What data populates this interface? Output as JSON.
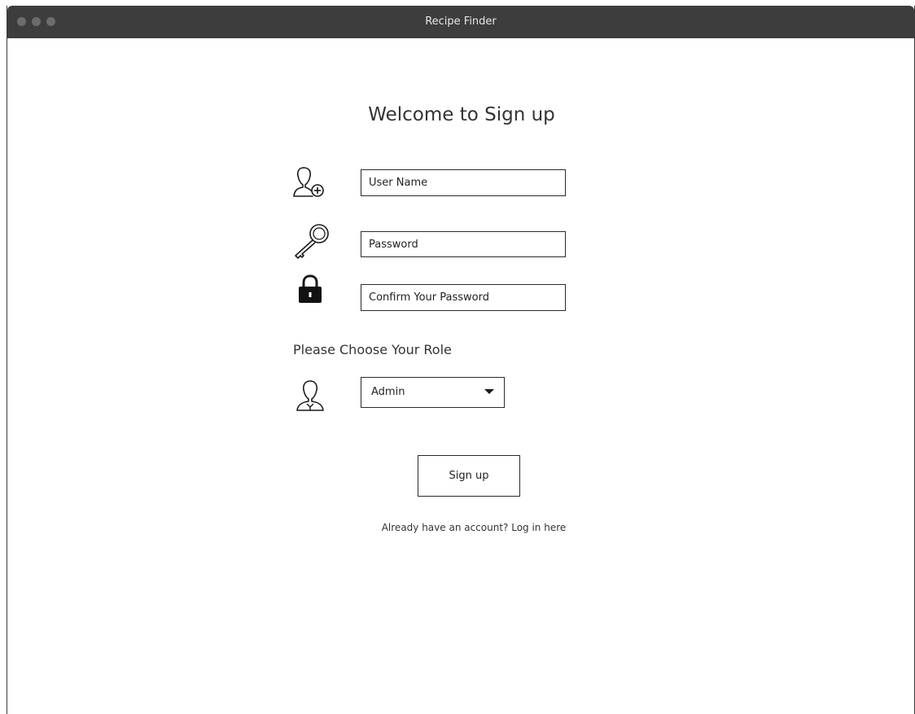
{
  "window": {
    "title": "Recipe Finder"
  },
  "form": {
    "heading": "Welcome to Sign up",
    "username_placeholder": "User Name",
    "password_placeholder": "Password",
    "confirm_password_placeholder": "Confirm Your Password",
    "role_label": "Please Choose Your Role",
    "role_selected": "Admin",
    "signup_label": "Sign up",
    "login_link": "Already have an account? Log in here"
  },
  "icons": {
    "username": "user-add-icon",
    "password": "key-icon",
    "confirm_password": "lock-icon",
    "role": "user-role-icon",
    "role_dropdown": "caret-down-icon"
  },
  "colors": {
    "titlebar": "#3d3d3d",
    "border": "#2a2a2a",
    "text": "#333333"
  }
}
